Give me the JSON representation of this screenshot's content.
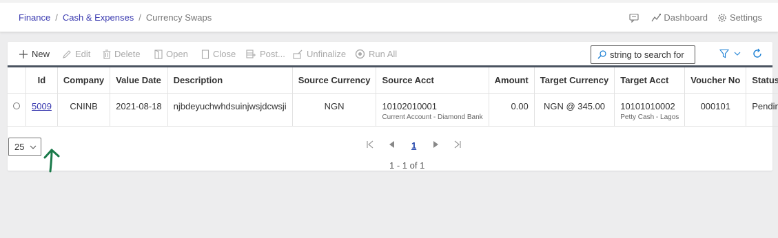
{
  "breadcrumb": {
    "items": [
      "Finance",
      "Cash & Expenses"
    ],
    "current": "Currency Swaps",
    "separator": "/"
  },
  "header_actions": {
    "chat_icon": "chat-icon",
    "dashboard": "Dashboard",
    "settings": "Settings"
  },
  "toolbar": {
    "new": "New",
    "edit": "Edit",
    "delete": "Delete",
    "open": "Open",
    "close": "Close",
    "post": "Post...",
    "unfinalize": "Unfinalize",
    "run_all": "Run All"
  },
  "search": {
    "placeholder": "string to search for"
  },
  "table": {
    "headers": [
      "Id",
      "Company",
      "Value Date",
      "Description",
      "Source Currency",
      "Source Acct",
      "Amount",
      "Target Currency",
      "Target Acct",
      "Voucher No",
      "Status"
    ],
    "rows": [
      {
        "id": "5009",
        "company": "CNINB",
        "value_date": "2021-08-18",
        "description": "njbdeyuchwhdsuinjwsjdcwsji",
        "source_currency": "NGN",
        "source_acct": "10102010001",
        "source_acct_name": "Current Account - Diamond Bank",
        "amount": "0.00",
        "target_currency": "NGN @ 345.00",
        "target_acct": "10101010002",
        "target_acct_name": "Petty Cash - Lagos",
        "voucher_no": "000101",
        "status": "Pending"
      }
    ]
  },
  "pager": {
    "page_size": "25",
    "current_page": "1",
    "info": "1 - 1 of 1"
  },
  "colors": {
    "link": "#3a3ab0",
    "accent": "#1a7fd4",
    "annotation": "#1a7a4a"
  }
}
